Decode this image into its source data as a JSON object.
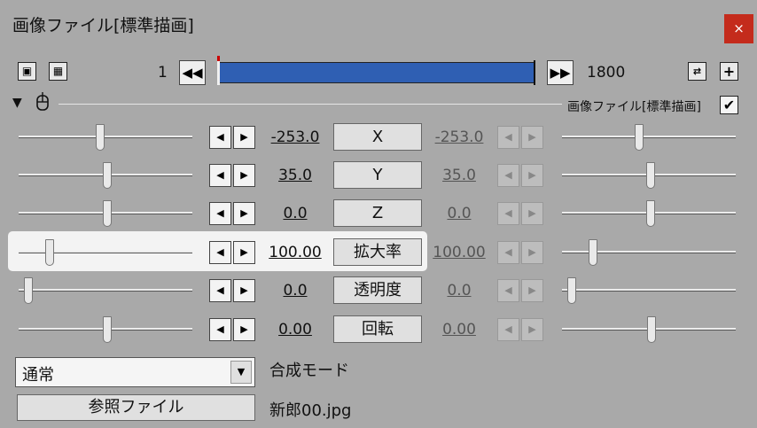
{
  "window": {
    "title": "画像ファイル[標準描画]",
    "close_glyph": "×"
  },
  "toolbar": {
    "start_frame": "1",
    "end_frame": "1800",
    "plus_glyph": "+",
    "prev_glyph": "◀◀",
    "next_glyph": "▶▶",
    "loop_glyph": "⇄"
  },
  "object": {
    "label": "画像ファイル[標準描画]",
    "checked": "✔",
    "collapse_glyph": "▼"
  },
  "params": [
    {
      "name": "X",
      "left_value": "-253.0",
      "right_value": "-253.0"
    },
    {
      "name": "Y",
      "left_value": "35.0",
      "right_value": "35.0"
    },
    {
      "name": "Z",
      "left_value": "0.0",
      "right_value": "0.0"
    },
    {
      "name": "拡大率",
      "left_value": "100.00",
      "right_value": "100.00"
    },
    {
      "name": "透明度",
      "left_value": "0.0",
      "right_value": "0.0"
    },
    {
      "name": "回転",
      "left_value": "0.00",
      "right_value": "0.00"
    }
  ],
  "arrows": {
    "left": "◀",
    "right": "▶",
    "down": "▼"
  },
  "blend": {
    "selected": "通常",
    "label": "合成モード"
  },
  "reference": {
    "button_label": "参照ファイル",
    "file_name": "新郎00.jpg"
  },
  "colors": {
    "accent": "#2f5fb3",
    "close": "#c42b1c",
    "background": "#a9a9a9"
  }
}
